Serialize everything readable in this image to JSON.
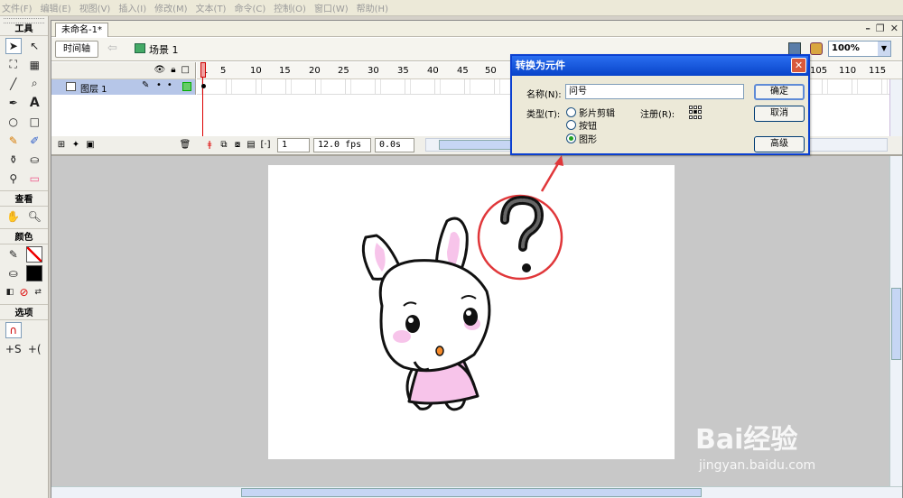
{
  "menu": [
    "文件(F)",
    "编辑(E)",
    "视图(V)",
    "插入(I)",
    "修改(M)",
    "文本(T)",
    "命令(C)",
    "控制(O)",
    "窗口(W)",
    "帮助(H)"
  ],
  "tools": {
    "title": "工具",
    "view_title": "查看",
    "colors_title": "颜色",
    "options_title": "选项"
  },
  "document": {
    "tab": "未命名-1*",
    "timeline_button": "时间轴",
    "scene": "场景 1",
    "zoom": "100%"
  },
  "timeline": {
    "layer_name": "图层 1",
    "ruler": [
      "1",
      "5",
      "10",
      "15",
      "20",
      "25",
      "30",
      "35",
      "40",
      "45",
      "50",
      "105",
      "110",
      "115"
    ],
    "current_frame": "1",
    "fps": "12.0 fps",
    "elapsed": "0.0s"
  },
  "dialog": {
    "title": "转换为元件",
    "name_label": "名称(N):",
    "name_value": "问号",
    "type_label": "类型(T):",
    "types": [
      "影片剪辑",
      "按钮",
      "图形"
    ],
    "selected_type": "图形",
    "registration_label": "注册(R):",
    "ok": "确定",
    "cancel": "取消",
    "advanced": "高级"
  },
  "colors": {
    "titlebar": "#0a3fd0",
    "accent_red": "#e0373a",
    "layer_highlight": "#b6c6e8",
    "bunny_pink": "#f7c4ea"
  },
  "watermark": {
    "brand": "Bai经验",
    "url": "jingyan.baidu.com"
  }
}
